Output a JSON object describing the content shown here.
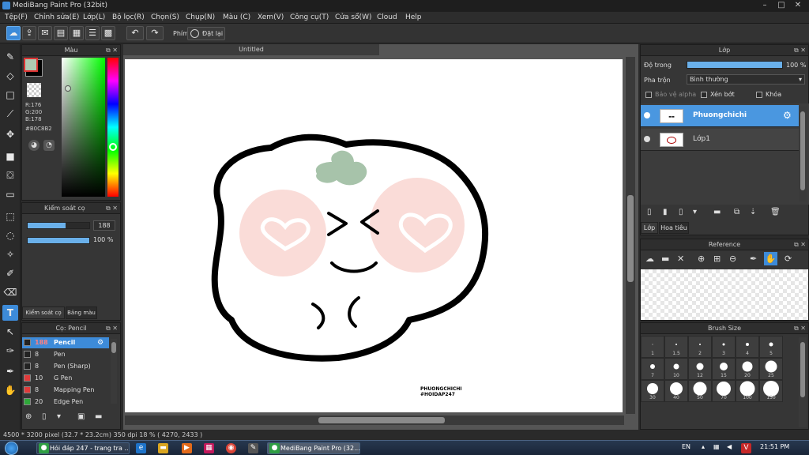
{
  "window": {
    "title": "MediBang Paint Pro (32bit)",
    "min": "–",
    "max": "□",
    "close": "✕"
  },
  "menu": [
    "Tệp(F)",
    "Chỉnh sửa(E)",
    "Lớp(L)",
    "Bộ lọc(R)",
    "Chọn(S)",
    "Chụp(N)",
    "Màu (C)",
    "Xem(V)",
    "Công cụ(T)",
    "Cửa sổ(W)",
    "Cloud",
    "Help"
  ],
  "toolbar": {
    "phim_label": "Phím",
    "reset_label": "Đặt lại"
  },
  "color_panel": {
    "title": "Màu",
    "r": "R:176",
    "g": "G:200",
    "b": "B:178",
    "hex": "#B0C8B2",
    "primary_color": "#b0c8b2"
  },
  "brush_control": {
    "title": "Kiểm soát cọ",
    "size": "188",
    "opacity": "100 %",
    "size_fraction": 0.62,
    "opacity_fraction": 1.0,
    "tab1": "Kiểm soát cọ",
    "tab2": "Bảng màu"
  },
  "brush_panel": {
    "title": "Cọ: Pencil",
    "items": [
      {
        "size": "188",
        "name": "Pencil",
        "color": "#222222",
        "selected": true
      },
      {
        "size": "8",
        "name": "Pen",
        "color": "#222222",
        "selected": false
      },
      {
        "size": "8",
        "name": "Pen (Sharp)",
        "color": "#222222",
        "selected": false
      },
      {
        "size": "10",
        "name": "G Pen",
        "color": "#e03a3a",
        "selected": false
      },
      {
        "size": "8",
        "name": "Mapping Pen",
        "color": "#e03a3a",
        "selected": false
      },
      {
        "size": "20",
        "name": "Edge Pen",
        "color": "#2fa83a",
        "selected": false
      }
    ]
  },
  "document": {
    "tab": "Untitled",
    "signature_line1": "PHUONGCHICHI",
    "signature_line2": "#HOIDAP247"
  },
  "layers_panel": {
    "title": "Lớp",
    "opacity_label": "Độ trong",
    "opacity_value": "100 %",
    "opacity_fraction": 1.0,
    "blend_label": "Pha trộn",
    "blend_value": "Bình thường",
    "protect_alpha": "Bảo vệ alpha",
    "clip": "Xén bớt",
    "lock": "Khóa",
    "layers": [
      {
        "name": "Phuongchichi",
        "selected": true
      },
      {
        "name": "Lớp1",
        "selected": false
      }
    ],
    "tab1": "Lớp",
    "tab2": "Hoa tiêu"
  },
  "reference_panel": {
    "title": "Reference"
  },
  "brush_size_panel": {
    "title": "Brush Size",
    "sizes": [
      "1",
      "1.5",
      "2",
      "3",
      "4",
      "5",
      "7",
      "10",
      "12",
      "15",
      "20",
      "25",
      "30",
      "40",
      "50",
      "70",
      "100",
      "150"
    ]
  },
  "status": {
    "text": "4500 * 3200 pixel   (32.7 * 23.2cm)   350 dpi   18 %   ( 4270, 2433 )"
  },
  "taskbar": {
    "task1": "Hỏi đáp 247 - trang tra ...",
    "task2": "MediBang Paint Pro (32...",
    "lang": "EN",
    "time": "21:51 PM"
  }
}
